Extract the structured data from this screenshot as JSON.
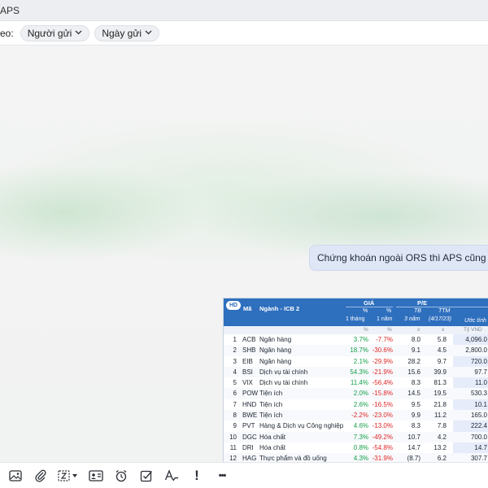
{
  "topbar": {
    "title": "APS"
  },
  "filters": {
    "label": "eo:",
    "sender_label": "Người gửi",
    "date_label": "Ngày gửi"
  },
  "message": {
    "text": "Chứng khoán ngoài ORS thì APS cũng dc nhé A"
  },
  "stock_table": {
    "badge": "HD",
    "headers": {
      "code": "Mã",
      "industry": "Ngành - ICB 2",
      "price_group": "GIÁ",
      "pe_group": "P/E",
      "pct1": "%",
      "pct2": "%",
      "one_month": "1 tháng",
      "one_year": "1 năm",
      "tb": "TB",
      "three_years": "3 năm",
      "ttm": "TTM",
      "ttm_date": "(4/17/23)",
      "est": "Ước tính",
      "unit_pct1": "%",
      "unit_pct2": "%",
      "unit_x1": "x",
      "unit_x2": "x",
      "unit_vnd": "Tỷ VND"
    },
    "rows": [
      {
        "no": "1",
        "code": "ACB",
        "industry": "Ngân hàng",
        "m1": "3.7%",
        "y1": "-7.7%",
        "tb": "8.0",
        "ttm": "5.8",
        "est": "4,096.0"
      },
      {
        "no": "2",
        "code": "SHB",
        "industry": "Ngân hàng",
        "m1": "18.7%",
        "y1": "-30.6%",
        "tb": "9.1",
        "ttm": "4.5",
        "est": "2,800.0"
      },
      {
        "no": "3",
        "code": "EIB",
        "industry": "Ngân hàng",
        "m1": "2.1%",
        "y1": "-29.9%",
        "tb": "28.2",
        "ttm": "9.7",
        "est": "720.0"
      },
      {
        "no": "4",
        "code": "BSI",
        "industry": "Dịch vụ tài chính",
        "m1": "54.3%",
        "y1": "-21.9%",
        "tb": "15.6",
        "ttm": "39.9",
        "est": "97.7"
      },
      {
        "no": "5",
        "code": "VIX",
        "industry": "Dịch vụ tài chính",
        "m1": "11.4%",
        "y1": "-56.4%",
        "tb": "8.3",
        "ttm": "81.3",
        "est": "11.0"
      },
      {
        "no": "6",
        "code": "POW",
        "industry": "Tiện ích",
        "m1": "2.0%",
        "y1": "-15.8%",
        "tb": "14.5",
        "ttm": "19.5",
        "est": "530.3"
      },
      {
        "no": "7",
        "code": "HND",
        "industry": "Tiện ích",
        "m1": "2.6%",
        "y1": "-16.5%",
        "tb": "9.5",
        "ttm": "21.8",
        "est": "10.1"
      },
      {
        "no": "8",
        "code": "BWE",
        "industry": "Tiện ích",
        "m1": "-2.2%",
        "y1": "-23.0%",
        "tb": "9.9",
        "ttm": "11.2",
        "est": "165.0"
      },
      {
        "no": "9",
        "code": "PVT",
        "industry": "Hàng & Dịch vụ Công nghiệp",
        "m1": "4.6%",
        "y1": "-13.0%",
        "tb": "8.3",
        "ttm": "7.8",
        "est": "222.4"
      },
      {
        "no": "10",
        "code": "DGC",
        "industry": "Hóa chất",
        "m1": "7.3%",
        "y1": "-49.2%",
        "tb": "10.7",
        "ttm": "4.2",
        "est": "700.0"
      },
      {
        "no": "11",
        "code": "DRI",
        "industry": "Hóa chất",
        "m1": "0.8%",
        "y1": "-54.8%",
        "tb": "14.7",
        "ttm": "13.2",
        "est": "14.7"
      },
      {
        "no": "12",
        "code": "HAG",
        "industry": "Thực phẩm và đồ uống",
        "m1": "4.3%",
        "y1": "-31.9%",
        "tb": "(8.7)",
        "ttm": "6.2",
        "est": "307.7"
      }
    ]
  },
  "toolbar": {
    "icons": [
      "image-icon",
      "attachment-icon",
      "screenshot-icon",
      "contact-card-icon",
      "alarm-icon",
      "task-icon",
      "format-text-icon",
      "important-icon",
      "more-icon"
    ],
    "important_glyph": "!",
    "more_glyph": "•••"
  },
  "colors": {
    "header_blue": "#2e6fbe",
    "positive": "#16a04a",
    "negative": "#e02525",
    "bubble": "#dfe7f6"
  }
}
